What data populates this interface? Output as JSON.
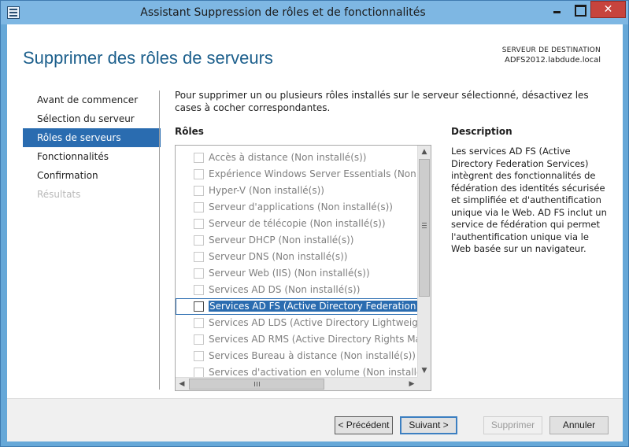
{
  "window": {
    "title": "Assistant Suppression de rôles et de fonctionnalités"
  },
  "header": {
    "page_title": "Supprimer des rôles de serveurs",
    "dest_label": "SERVEUR DE DESTINATION",
    "dest_server": "ADFS2012.labdude.local"
  },
  "nav": {
    "items": [
      {
        "label": "Avant de commencer",
        "state": "normal"
      },
      {
        "label": "Sélection du serveur",
        "state": "normal"
      },
      {
        "label": "Rôles de serveurs",
        "state": "active"
      },
      {
        "label": "Fonctionnalités",
        "state": "normal"
      },
      {
        "label": "Confirmation",
        "state": "normal"
      },
      {
        "label": "Résultats",
        "state": "disabled"
      }
    ]
  },
  "main": {
    "intro": "Pour supprimer un ou plusieurs rôles installés sur le serveur sélectionné, désactivez les cases à cocher correspondantes.",
    "roles_label": "Rôles",
    "roles": [
      {
        "label": "Accès à distance (Non installé(s))",
        "checked": false,
        "selected": false
      },
      {
        "label": "Expérience Windows Server Essentials (Non installé(s))",
        "checked": false,
        "selected": false
      },
      {
        "label": "Hyper-V (Non installé(s))",
        "checked": false,
        "selected": false
      },
      {
        "label": "Serveur d'applications (Non installé(s))",
        "checked": false,
        "selected": false
      },
      {
        "label": "Serveur de télécopie (Non installé(s))",
        "checked": false,
        "selected": false
      },
      {
        "label": "Serveur DHCP (Non installé(s))",
        "checked": false,
        "selected": false
      },
      {
        "label": "Serveur DNS (Non installé(s))",
        "checked": false,
        "selected": false
      },
      {
        "label": "Serveur Web (IIS) (Non installé(s))",
        "checked": false,
        "selected": false
      },
      {
        "label": "Services AD DS (Non installé(s))",
        "checked": false,
        "selected": false
      },
      {
        "label": "Services AD FS (Active Directory Federation Services)",
        "checked": false,
        "selected": true
      },
      {
        "label": "Services AD LDS (Active Directory Lightweight Directory Services)",
        "checked": false,
        "selected": false
      },
      {
        "label": "Services AD RMS (Active Directory Rights Management Services)",
        "checked": false,
        "selected": false
      },
      {
        "label": "Services Bureau à distance (Non installé(s))",
        "checked": false,
        "selected": false
      },
      {
        "label": "Services d'activation en volume (Non installé(s))",
        "checked": false,
        "selected": false
      }
    ],
    "description_title": "Description",
    "description_text": "Les services AD FS (Active Directory Federation Services) intègrent des fonctionnalités de fédération des identités sécurisée et simplifiée et d'authentification unique via le Web. AD FS inclut un service de fédération qui permet l'authentification unique via le Web basée sur un navigateur."
  },
  "footer": {
    "prev_label": "< Précédent",
    "next_label": "Suivant >",
    "finish_label": "Supprimer",
    "cancel_label": "Annuler"
  },
  "colors": {
    "accent": "#2a6cb0",
    "title_bar": "#7eb7e3",
    "page_title": "#1c5f8c",
    "close_button": "#c7443d"
  },
  "icons": [
    "app-icon",
    "minimize-icon",
    "maximize-icon",
    "close-icon",
    "scroll-up-icon",
    "scroll-down-icon",
    "scroll-left-icon",
    "scroll-right-icon"
  ]
}
